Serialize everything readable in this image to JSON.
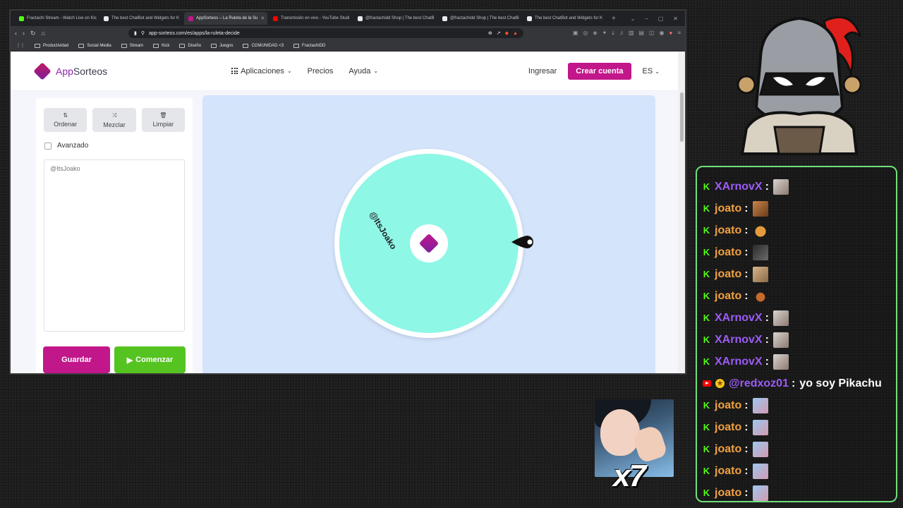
{
  "browser": {
    "tabs": [
      {
        "label": "Fractachi Stream - Watch Live on Kic",
        "color": "#53fc18",
        "active": false
      },
      {
        "label": "The best ChatBot and Widgets for K",
        "color": "#e8eaed",
        "active": false
      },
      {
        "label": "AppSorteos – La Ruleta de la Su",
        "color": "#c2178a",
        "active": true
      },
      {
        "label": "Transmisión en vivo - YouTube Studi",
        "color": "#ff0000",
        "active": false
      },
      {
        "label": "@fractachidd Shop | The best ChatB",
        "color": "#e8eaed",
        "active": false
      },
      {
        "label": "@fractachidd Shop | The best ChatB",
        "color": "#e8eaed",
        "active": false
      },
      {
        "label": "The best ChatBot and Widgets for K",
        "color": "#e8eaed",
        "active": false
      }
    ],
    "url": "app-sorteos.com/es/apps/la-ruleta-decide",
    "bookmarks": [
      "Productividad",
      "Social Media",
      "Stream",
      "Kick",
      "Diseño",
      "Juegos",
      "COMUNIDAD <3",
      "FractachiDD"
    ]
  },
  "site": {
    "logo_prefix": "App",
    "logo_suffix": "Sorteos",
    "nav": {
      "apps": "Aplicaciones",
      "prices": "Precios",
      "help": "Ayuda"
    },
    "login": "Ingresar",
    "create_account": "Crear cuenta",
    "lang": "ES"
  },
  "panel": {
    "tools": {
      "sort": "Ordenar",
      "shuffle": "Mezclar",
      "clear": "Limpiar"
    },
    "advanced_label": "Avanzado",
    "entries": "@ItsJoako",
    "save": "Guardar",
    "start": "Comenzar"
  },
  "wheel": {
    "entry": "@ItsJoako",
    "color": "#8ef7e6"
  },
  "chat": {
    "messages": [
      {
        "user": "XArnovX",
        "platform": "kick",
        "color": "purple",
        "emote": "e1",
        "text": ""
      },
      {
        "user": "joato",
        "platform": "kick",
        "color": "orange",
        "emote": "e2",
        "text": ""
      },
      {
        "user": "joato",
        "platform": "kick",
        "color": "orange",
        "emote": "e3",
        "text": ""
      },
      {
        "user": "joato",
        "platform": "kick",
        "color": "orange",
        "emote": "e4",
        "text": ""
      },
      {
        "user": "joato",
        "platform": "kick",
        "color": "orange",
        "emote": "e5",
        "text": ""
      },
      {
        "user": "joato",
        "platform": "kick",
        "color": "orange",
        "emote": "e6",
        "text": ""
      },
      {
        "user": "XArnovX",
        "platform": "kick",
        "color": "purple",
        "emote": "e1",
        "text": ""
      },
      {
        "user": "XArnovX",
        "platform": "kick",
        "color": "purple",
        "emote": "e1",
        "text": ""
      },
      {
        "user": "XArnovX",
        "platform": "kick",
        "color": "purple",
        "emote": "e1",
        "text": ""
      },
      {
        "user": "@redxoz01",
        "platform": "youtube",
        "color": "purple",
        "emote": "",
        "text": "yo soy Pikachu"
      },
      {
        "user": "joato",
        "platform": "kick",
        "color": "orange",
        "emote": "e7",
        "text": ""
      },
      {
        "user": "joato",
        "platform": "kick",
        "color": "orange",
        "emote": "e7",
        "text": ""
      },
      {
        "user": "joato",
        "platform": "kick",
        "color": "orange",
        "emote": "e7",
        "text": ""
      },
      {
        "user": "joato",
        "platform": "kick",
        "color": "orange",
        "emote": "e7",
        "text": ""
      },
      {
        "user": "joato",
        "platform": "kick",
        "color": "orange",
        "emote": "e7",
        "text": ""
      }
    ]
  },
  "alert": {
    "multiplier": "x7"
  }
}
